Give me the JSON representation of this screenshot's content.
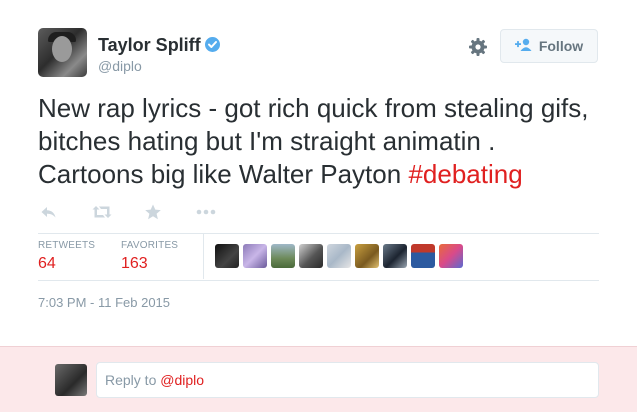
{
  "user": {
    "display_name": "Taylor Spliff",
    "handle": "@diplo",
    "verified": true
  },
  "follow_button": {
    "label": "Follow",
    "icon": "add-user-icon"
  },
  "settings_icon": "gear-icon",
  "tweet": {
    "text_main": "New rap lyrics - got rich quick from stealing gifs, bitches hating but I'm straight animatin . Cartoons big like Walter Payton ",
    "hashtag": "#debating",
    "timestamp": "7:03 PM - 11 Feb 2015"
  },
  "actions": [
    {
      "name": "reply",
      "icon": "reply-icon"
    },
    {
      "name": "retweet",
      "icon": "retweet-icon"
    },
    {
      "name": "favorite",
      "icon": "star-icon"
    },
    {
      "name": "more",
      "icon": "more-icon"
    }
  ],
  "stats": {
    "retweets_label": "RETWEETS",
    "retweets_value": "64",
    "favorites_label": "FAVORITES",
    "favorites_value": "163"
  },
  "favoriter_avatars_count": 9,
  "reply_box": {
    "prefix": "Reply to ",
    "mention": "@diplo"
  },
  "colors": {
    "accent": "#e02020",
    "verified": "#55acee",
    "muted": "#8899a6",
    "reply_bg": "#fce8ea"
  }
}
